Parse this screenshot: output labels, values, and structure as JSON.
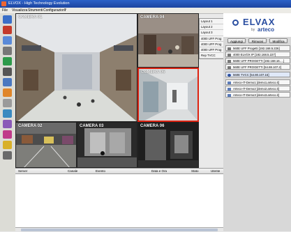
{
  "window": {
    "title": "ELVOX - High Technology Evolution"
  },
  "menu": [
    {
      "label": "File"
    },
    {
      "label": "Visualizza"
    },
    {
      "label": "Strumenti"
    },
    {
      "label": "Configurazioni"
    },
    {
      "label": "?"
    }
  ],
  "cameras": [
    {
      "label": "CAMERA 01"
    },
    {
      "label": "CAMERA 04"
    },
    {
      "label": "CAMERA 05"
    },
    {
      "label": "CAMERA 02"
    },
    {
      "label": "CAMERA 03"
    },
    {
      "label": "CAMERA 06"
    }
  ],
  "layouts": [
    {
      "label": "Layout 1"
    },
    {
      "label": "Layout 2"
    },
    {
      "label": "Layout 3"
    },
    {
      "label": "4000 UFF Prog"
    },
    {
      "label": "4000 UFF Prog"
    },
    {
      "label": "4000 UFF Prog"
    },
    {
      "label": "Rep TVCC"
    }
  ],
  "brand": {
    "name": "ELVAX",
    "by": "by",
    "partner": "arteco"
  },
  "actions": {
    "add": "Aggiungi",
    "remove": "Rimuovi",
    "edit": "Modifica"
  },
  "sites": [
    {
      "label": "560E UFF Progetti [192.168.5.226]"
    },
    {
      "label": "4000 ELVOX IP [192.168.5.227]"
    },
    {
      "label": "560E UFF PROGETTI [192.168.16.…]"
    },
    {
      "label": "560E UFF PROGETTI [54.88.107.2]"
    },
    {
      "label": "560E TVCC [54.80.107.15]"
    },
    {
      "label": "Arteco-IT-Demo1 [demo1.arteco.it]"
    },
    {
      "label": "Arteco-IT-Demo2 [demo2.arteco.it]"
    },
    {
      "label": "Arteco-IT-Demo3 [demo3.arteco.it]"
    }
  ],
  "events": {
    "columns": [
      {
        "label": "Server"
      },
      {
        "label": "Canale"
      },
      {
        "label": "Evento"
      },
      {
        "label": "Data e Ora"
      },
      {
        "label": "Stato"
      },
      {
        "label": "Utente"
      }
    ]
  },
  "colors": {
    "title_bar": "#1c44a0",
    "selected_border": "#d21111",
    "brand": "#2a4ea0"
  }
}
